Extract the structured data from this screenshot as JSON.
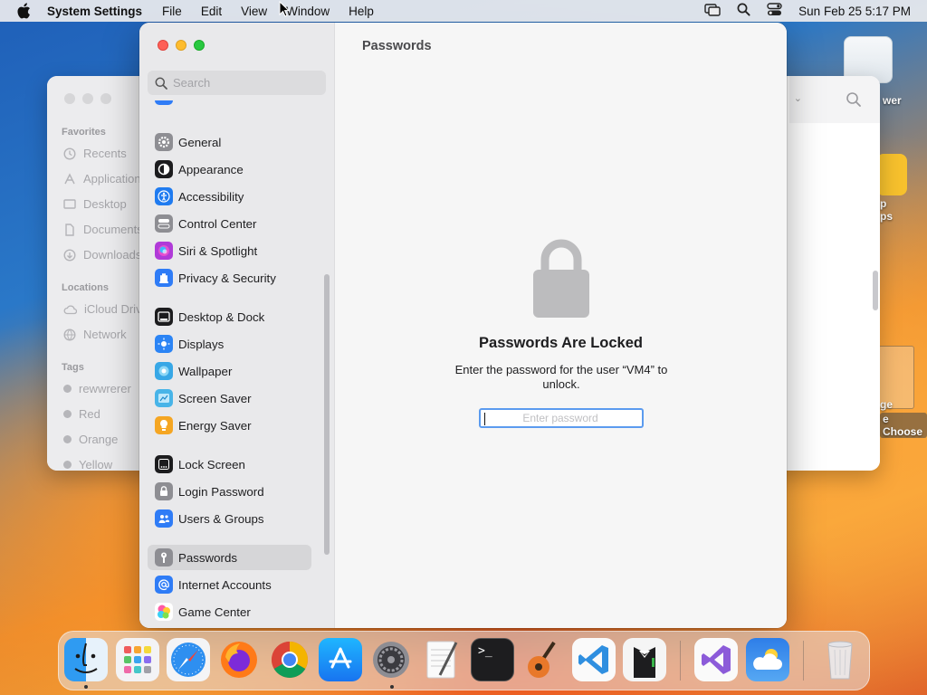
{
  "menubar": {
    "app_name": "System Settings",
    "menus": [
      "File",
      "Edit",
      "View",
      "Window",
      "Help"
    ],
    "clock": "Sun Feb 25  5:17 PM"
  },
  "finder": {
    "favorites_header": "Favorites",
    "favorites": [
      "Recents",
      "Applications",
      "Desktop",
      "Documents",
      "Downloads"
    ],
    "locations_header": "Locations",
    "locations": [
      "iCloud Drive",
      "Network"
    ],
    "tags_header": "Tags",
    "tags": [
      "rewwrerer",
      "Red",
      "Orange",
      "Yellow"
    ]
  },
  "desktop_icons": [
    "wer",
    "p ps",
    "ge",
    "e Choose"
  ],
  "settings": {
    "search_placeholder": "Search",
    "nav_items": [
      {
        "label": "General",
        "icon": "gear-icon",
        "color": "#8e8e93"
      },
      {
        "label": "Appearance",
        "icon": "appearance-icon",
        "color": "#1c1c1e"
      },
      {
        "label": "Accessibility",
        "icon": "accessibility-icon",
        "color": "#1f7bf0"
      },
      {
        "label": "Control Center",
        "icon": "control-center-icon",
        "color": "#8e8e93"
      },
      {
        "label": "Siri & Spotlight",
        "icon": "siri-icon",
        "color": "#b03ad8"
      },
      {
        "label": "Privacy & Security",
        "icon": "hand-icon",
        "color": "#2f7cf6"
      },
      {
        "label": "Desktop & Dock",
        "icon": "dock-icon",
        "color": "#1c1c1e"
      },
      {
        "label": "Displays",
        "icon": "sun-icon",
        "color": "#2b84f5"
      },
      {
        "label": "Wallpaper",
        "icon": "wallpaper-icon",
        "color": "#37a7e6"
      },
      {
        "label": "Screen Saver",
        "icon": "screen-saver-icon",
        "color": "#48b4e8"
      },
      {
        "label": "Energy Saver",
        "icon": "battery-icon",
        "color": "#f5a623"
      },
      {
        "label": "Lock Screen",
        "icon": "lock-screen-icon",
        "color": "#1c1c1e"
      },
      {
        "label": "Login Password",
        "icon": "lock-icon",
        "color": "#8e8e93"
      },
      {
        "label": "Users & Groups",
        "icon": "users-icon",
        "color": "#2f7cf6"
      },
      {
        "label": "Passwords",
        "icon": "key-icon",
        "color": "#8e8e93"
      },
      {
        "label": "Internet Accounts",
        "icon": "at-icon",
        "color": "#2f7cf6"
      },
      {
        "label": "Game Center",
        "icon": "game-center-icon",
        "color": "#ffffff"
      }
    ],
    "selected": "Passwords",
    "page_title": "Passwords",
    "lock_title": "Passwords Are Locked",
    "lock_message": "Enter the password for the user “VM4” to unlock.",
    "password_placeholder": "Enter password"
  },
  "dock": {
    "apps": [
      "Finder",
      "Launchpad",
      "Safari",
      "Firefox",
      "Google Chrome",
      "App Store",
      "System Settings",
      "TextEdit",
      "Terminal",
      "GarageBand",
      "Visual Studio Code",
      "Bartender",
      "Visual Studio",
      "Weather",
      "Trash"
    ]
  }
}
